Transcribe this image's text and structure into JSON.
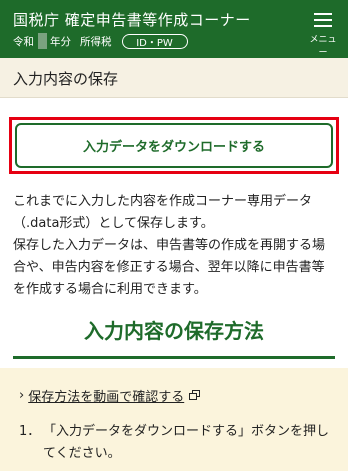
{
  "header": {
    "title": "国税庁 確定申告書等作成コーナー",
    "era": "令和",
    "year_suffix": "年分",
    "tax_type": "所得税",
    "id_pw": "ID・PW",
    "menu_label": "メニュー",
    "bg_color": "#1e6b2a"
  },
  "section": {
    "title": "入力内容の保存"
  },
  "download": {
    "button_label": "入力データをダウンロードする",
    "highlight_color": "#e60012"
  },
  "description": [
    "これまでに入力した内容を作成コーナー専用データ（.data形式）として保存します。",
    "保存した入力データは、申告書等の作成を再開する場合や、申告内容を修正する場合、翌年以降に申告書等を作成する場合に利用できます。"
  ],
  "howto": {
    "heading": "入力内容の保存方法",
    "video_link": "保存方法を動画で確認する",
    "steps": [
      {
        "number": "1．",
        "text": "「入力データをダウンロードする」ボタンを押してください。"
      }
    ]
  }
}
